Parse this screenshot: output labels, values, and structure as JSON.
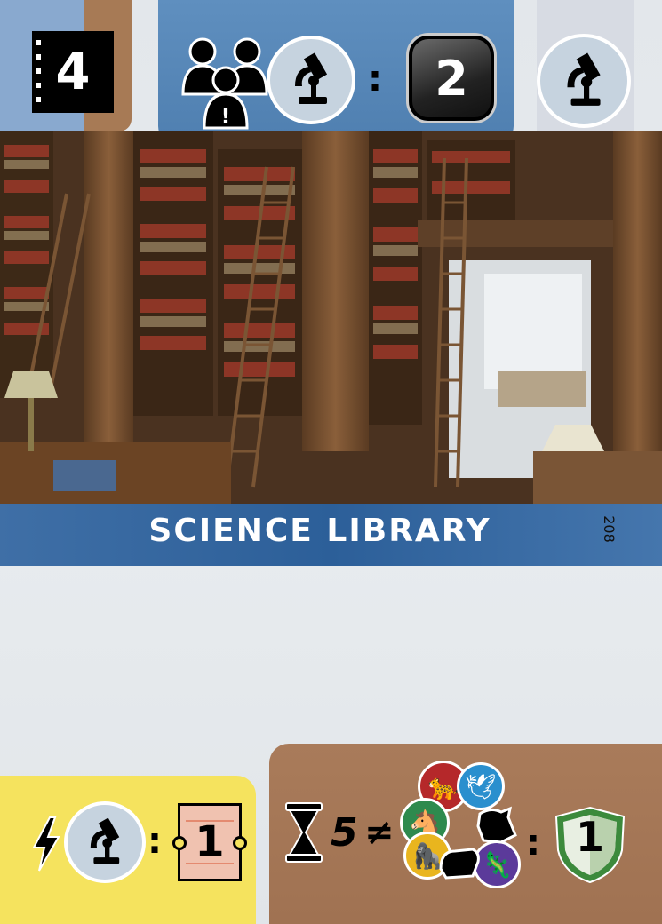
{
  "card": {
    "cost": "4",
    "name": "SCIENCE LIBRARY",
    "number": "208"
  },
  "requirement": {
    "condition_icons": [
      "partners-icon",
      "science-icon"
    ],
    "separator": ":",
    "value": "2",
    "reward_icon": "science-icon"
  },
  "effect": {
    "trigger_icon": "lightning-icon",
    "icon": "science-icon",
    "separator": ":",
    "reward_value": "1",
    "reward_icon": "ticket-icon"
  },
  "endgame": {
    "trigger_icon": "hourglass-icon",
    "count": "5",
    "symbol": "≠",
    "animal_icons": [
      "predator-icon",
      "bird-icon",
      "herbivore-icon",
      "primate-icon",
      "reptile-icon",
      "bear-icon",
      "goat-icon"
    ],
    "separator": ":",
    "reward_value": "1",
    "reward_icon": "shield-icon"
  },
  "colors": {
    "header_blue": "#4f7fb0",
    "title_blue": "#2c5f99",
    "yellow": "#f5e35e",
    "brown": "#a07252",
    "icon_circle": "#c6d3df",
    "ticket": "#f0c2b0",
    "shield_green": "#3c8a3c"
  }
}
